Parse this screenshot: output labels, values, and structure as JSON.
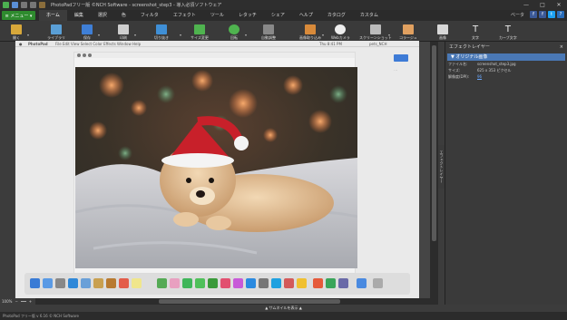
{
  "window": {
    "title": "PhotoPadフリー版 ©NCH Software - screenshot_step3 - 導入必須ソフトウェア",
    "minimize": "—",
    "maximize": "□",
    "close": "✕"
  },
  "menubar": {
    "menu_button": "≡ メニュー ▾",
    "tabs": [
      "ホーム",
      "編集",
      "選択",
      "色",
      "フィルタ",
      "エフェクト",
      "ツール",
      "レタッチ",
      "シェア",
      "ヘルプ",
      "カタログ",
      "カスタム"
    ],
    "beta": "ベータ",
    "social": [
      "f",
      "f",
      "t",
      "?"
    ]
  },
  "toolbar": {
    "open": "開く",
    "library": "ライブラリ",
    "save": "保存",
    "print": "印刷",
    "crop": "切り抜き",
    "resize": "サイズ変更",
    "rotate": "回転",
    "auto_adjust": "自動調整",
    "image_import": "画像取り込み",
    "webcam": "Webカメラ",
    "screenshot": "スクリーンショット",
    "collage": "コラージュ",
    "image": "画像",
    "text": "文字",
    "curved_text": "カーブ文字"
  },
  "inner_screenshot": {
    "app_name": "PhotoPad",
    "menu": "File   Edit   View   Select   Color   Effects   Window   Help",
    "clock": "Thu 8:41 PM",
    "user": "pets_NCH"
  },
  "zoom": {
    "value": "100%",
    "minus": "−",
    "plus": "+"
  },
  "thumbnail_bar": "▲ サムネイルを表示 ▲",
  "status_bar": "PhotoPad フリー版 v 6.16 © NCH Software",
  "right_panel": {
    "title": "エフェクトレイヤー",
    "section": "▼ オリジナル画像",
    "file_key": "ファイル名:",
    "file_val": "screenshot_step3.jpg",
    "size_key": "サイズ:",
    "size_val": "625 x 353 ピクセル",
    "dpi_key": "解像度(DPI):",
    "dpi_val": "96",
    "side_tab": "エフェクトレイヤー"
  }
}
